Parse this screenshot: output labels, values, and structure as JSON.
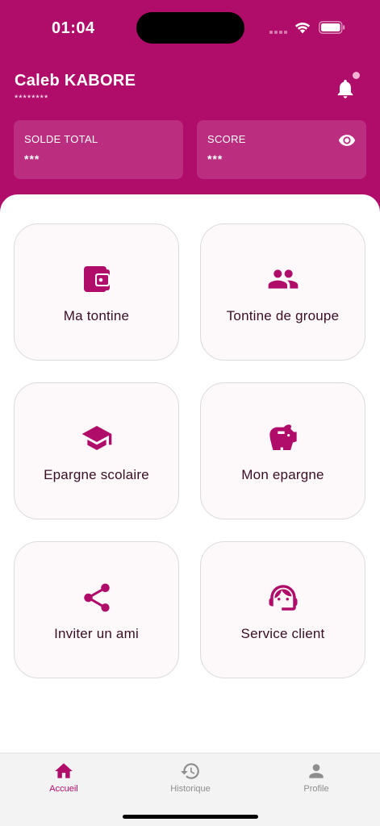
{
  "status_bar": {
    "time": "01:04"
  },
  "header": {
    "user_name": "Caleb KABORE",
    "user_sub": "********",
    "cards": [
      {
        "label": "SOLDE TOTAL",
        "value": "***"
      },
      {
        "label": "SCORE",
        "value": "***"
      }
    ],
    "icons": {
      "notification": "bell-icon",
      "visibility": "eye-icon"
    }
  },
  "tiles": [
    {
      "label": "Ma tontine",
      "icon": "wallet-icon"
    },
    {
      "label": "Tontine de groupe",
      "icon": "group-icon"
    },
    {
      "label": "Epargne scolaire",
      "icon": "graduation-cap-icon"
    },
    {
      "label": "Mon epargne",
      "icon": "piggy-bank-icon"
    },
    {
      "label": "Inviter un ami",
      "icon": "share-icon"
    },
    {
      "label": "Service client",
      "icon": "support-agent-icon"
    }
  ],
  "bottom_nav": [
    {
      "label": "Accueil",
      "icon": "home-icon",
      "active": true
    },
    {
      "label": "Historique",
      "icon": "history-icon",
      "active": false
    },
    {
      "label": "Profile",
      "icon": "person-icon",
      "active": false
    }
  ],
  "colors": {
    "brand": "#B00C6A",
    "tile_background": "#FDF8FA",
    "tile_border": "#DCDCDC",
    "label_text": "#3A0E25",
    "nav_active": "#B00C6A",
    "nav_inactive": "#8E8E8E",
    "notification_dot": "#F5B3D4"
  }
}
